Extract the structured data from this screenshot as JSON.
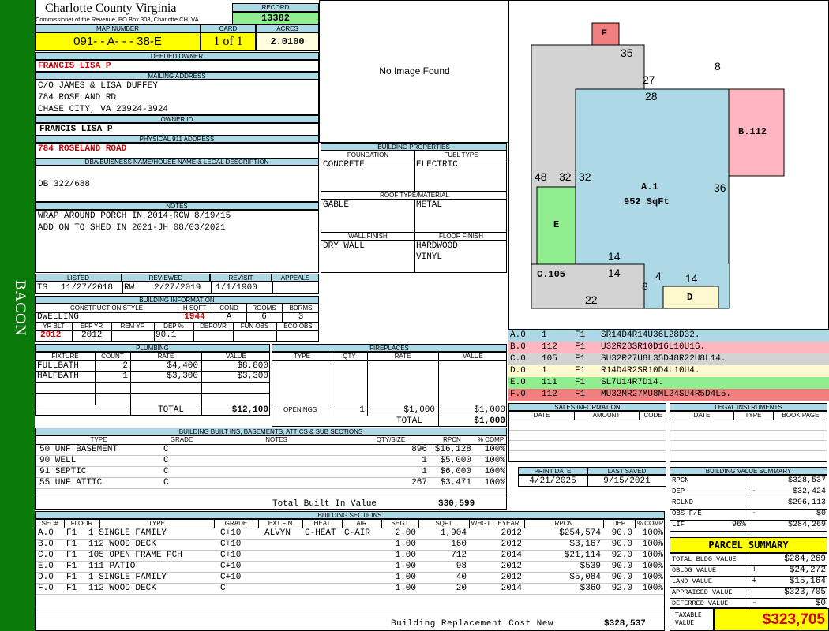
{
  "sidebar": {
    "label": "BACON",
    "color": "#087a08"
  },
  "header": {
    "county": "Charlotte County Virginia",
    "commissioner": "Commissioner of the Revenue, PO Box 308, Charlotte CH, VA",
    "record_label": "RECORD",
    "record": "13382",
    "map_number_label": "MAP NUMBER",
    "map_number": "091- - A- - - 38-E",
    "card_label": "CARD",
    "card": "1 of 1",
    "acres_label": "ACRES",
    "acres": "2.0100"
  },
  "owner": {
    "deeded_owner_label": "DEEDED OWNER",
    "deeded_owner": "FRANCIS LISA P",
    "mailing_label": "MAILING ADDRESS",
    "mailing": [
      "C/O JAMES & LISA DUFFEY",
      "784 ROSELAND RD",
      "CHASE CITY, VA 23924-3924"
    ],
    "owner_id_label": "OWNER ID",
    "owner_id": "FRANCIS LISA P",
    "physical_label": "PHYSICAL 911 ADDRESS",
    "physical": "784 ROSELAND ROAD",
    "dba_label": "DBA/BUISNESS NAME/HOUSE NAME & LEGAL DESCRIPTION",
    "dba": "DB 322/688",
    "notes_label": "NOTES",
    "notes": [
      "WRAP AROUND PORCH IN 2014-RCW 8/19/15",
      "ADD ON TO SHED IN 2021-JH 08/03/2021"
    ]
  },
  "image": {
    "text": "No Image Found"
  },
  "building_props": {
    "title": "BUILDING PROPERTIES",
    "foundation_label": "FOUNDATION",
    "foundation": "CONCRETE",
    "fuel_label": "FUEL TYPE",
    "fuel": "ELECTRIC",
    "roof_label": "ROOF TYPE/MATERIAL",
    "roof_type": "GABLE",
    "roof_material": "METAL",
    "wall_label": "WALL FINISH",
    "wall": "DRY WALL",
    "floor_label": "FLOOR FINISH",
    "floor": [
      "HARDWOOD",
      "VINYL"
    ]
  },
  "listing": {
    "listed_label": "LISTED",
    "listed_by": "TS",
    "listed_date": "11/27/2018",
    "reviewed_label": "REVIEWED",
    "reviewed_by": "RW",
    "reviewed_date": "2/27/2019",
    "revisit_label": "REVISIT",
    "revisit": "1/1/1900",
    "appeals_label": "APPEALS",
    "appeals": ""
  },
  "building_info": {
    "title": "BUILDING INFORMATION",
    "style_label": "CONSTRUCTION STYLE",
    "style": "DWELLING",
    "hsqft_label": "H SQFT",
    "hsqft": "1944",
    "cond_label": "COND",
    "cond": "A",
    "rooms_label": "ROOMS",
    "rooms": "6",
    "bdrms_label": "BDRMS",
    "bdrms": "3",
    "yrblt_label": "YR BLT",
    "yrblt": "2012",
    "effyr_label": "EFF YR",
    "effyr": "2012",
    "remyr_label": "REM YR",
    "remyr": "",
    "dep_label": "DEP %",
    "dep": "90.1",
    "depovr_label": "DEPOVR",
    "depovr": "",
    "funobs_label": "FUN OBS",
    "funobs": "",
    "ecoobs_label": "ECO OBS",
    "ecoobs": ""
  },
  "plumbing": {
    "title": "PLUMBING",
    "headers": [
      "FIXTURE",
      "COUNT",
      "RATE",
      "VALUE"
    ],
    "rows": [
      {
        "fixture": "FULLBATH",
        "count": "2",
        "rate": "$4,400",
        "value": "$8,800"
      },
      {
        "fixture": "HALFBATH",
        "count": "1",
        "rate": "$3,300",
        "value": "$3,300"
      }
    ],
    "total_label": "TOTAL",
    "total": "$12,100"
  },
  "fireplaces": {
    "title": "FIREPLACES",
    "headers": [
      "TYPE",
      "QTY",
      "RATE",
      "VALUE"
    ],
    "openings_label": "OPENINGS",
    "openings_qty": "1",
    "openings_rate": "$1,000",
    "openings_value": "$1,000",
    "total_label": "TOTAL",
    "total": "$1,000"
  },
  "built_ins": {
    "title": "BUILDING BUILT INS, BASEMENTS, ATTICS & SUB SECTIONS",
    "headers": [
      "TYPE",
      "GRADE",
      "NOTES",
      "QTY/SIZE",
      "RPCN",
      "% COMP"
    ],
    "rows": [
      {
        "type": "50 UNF BASEMENT",
        "grade": "C",
        "notes": "",
        "qty": "896",
        "rpcn": "$16,128",
        "comp": "100%"
      },
      {
        "type": "90 WELL",
        "grade": "C",
        "notes": "",
        "qty": "1",
        "rpcn": "$5,000",
        "comp": "100%"
      },
      {
        "type": "91 SEPTIC",
        "grade": "C",
        "notes": "",
        "qty": "1",
        "rpcn": "$6,000",
        "comp": "100%"
      },
      {
        "type": "55 UNF ATTIC",
        "grade": "C",
        "notes": "",
        "qty": "267",
        "rpcn": "$3,471",
        "comp": "100%"
      }
    ],
    "total_label": "Total Built In Value",
    "total": "$30,599"
  },
  "sketch": {
    "labels": {
      "F": "F",
      "B": "B.112",
      "A1": "A.1",
      "A2": "952 SqFt",
      "E": "E",
      "C": "C.105",
      "D": "D"
    },
    "dims": [
      "35",
      "8",
      "27",
      "28",
      "48",
      "32",
      "32",
      "36",
      "14",
      "14",
      "4",
      "14",
      "8",
      "22"
    ],
    "colors": {
      "A": "#add8e6",
      "B": "#ffb6c1",
      "C": "#d3d3d3",
      "D": "#fffacd",
      "E": "#90ee90",
      "F": "#f08080"
    }
  },
  "sketch_legend": [
    {
      "code": "A.0",
      "num": "1",
      "floor": "F1",
      "desc": "SR14D4R14U36L28D32.",
      "color": "#add8e6"
    },
    {
      "code": "B.0",
      "num": "112",
      "floor": "F1",
      "desc": "U32R28SR10D16L10U16.",
      "color": "#ffb6c1"
    },
    {
      "code": "C.0",
      "num": "105",
      "floor": "F1",
      "desc": "SU32R27U8L35D48R22U8L14.",
      "color": "#d3d3d3"
    },
    {
      "code": "D.0",
      "num": "1",
      "floor": "F1",
      "desc": "R14D4R2SR10D4L10U4.",
      "color": "#fffacd"
    },
    {
      "code": "E.0",
      "num": "111",
      "floor": "F1",
      "desc": "SL7U14R7D14.",
      "color": "#90ee90"
    },
    {
      "code": "F.0",
      "num": "112",
      "floor": "F1",
      "desc": "MU32MR27MU8ML24SU4R5D4L5.",
      "color": "#f08080"
    }
  ],
  "sales": {
    "title": "SALES INFORMATION",
    "headers": [
      "DATE",
      "AMOUNT",
      "CODE"
    ]
  },
  "legal": {
    "title": "LEGAL INSTRUMENTS",
    "headers": [
      "DATE",
      "TYPE",
      "BOOK PAGE"
    ]
  },
  "dates": {
    "print_label": "PRINT DATE",
    "print": "4/21/2025",
    "saved_label": "LAST SAVED",
    "saved": "9/15/2021"
  },
  "value_summary": {
    "title": "BUILDING VALUE SUMMARY",
    "rows": [
      {
        "label": "RPCN",
        "sign": "",
        "value": "$328,537"
      },
      {
        "label": "DEP",
        "sign": "-",
        "value": "$32,424"
      },
      {
        "label": "RCLND",
        "sign": "",
        "value": "$296,113"
      },
      {
        "label": "OBS F/E",
        "sign": "-",
        "value": "$0"
      },
      {
        "label": "LIF",
        "pct": "96%",
        "sign": "",
        "value": "$284,269"
      }
    ]
  },
  "parcel": {
    "title": "PARCEL SUMMARY",
    "rows": [
      {
        "label": "TOTAL BLDG VALUE",
        "sign": "",
        "value": "$284,269"
      },
      {
        "label": "OBLDG VALUE",
        "sign": "+",
        "value": "$24,272"
      },
      {
        "label": "LAND VALUE",
        "sign": "+",
        "value": "$15,164"
      },
      {
        "label": "APPRAISED VALUE",
        "sign": "",
        "value": "$323,705"
      },
      {
        "label": "DEFERRED VALUE",
        "sign": "-",
        "value": "$0"
      }
    ],
    "taxable_label": "TAXABLE VALUE",
    "taxable": "$323,705"
  },
  "sections": {
    "title": "BUILDING SECTIONS",
    "headers": [
      "SEC#",
      "FLOOR",
      "TYPE",
      "GRADE",
      "EXT FIN",
      "HEAT",
      "AIR",
      "SHGT",
      "SQFT",
      "WHGT",
      "EYEAR",
      "RPCN",
      "DEP",
      "% COMP"
    ],
    "rows": [
      {
        "sec": "A.0",
        "floor": "F1",
        "type": "1 SINGLE FAMILY",
        "grade": "C+10",
        "ext": "ALVYN",
        "heat": "C-HEAT",
        "air": "C-AIR",
        "shgt": "2.00",
        "sqft": "1,904",
        "whgt": "",
        "eyear": "2012",
        "rpcn": "$254,574",
        "dep": "90.0",
        "comp": "100%"
      },
      {
        "sec": "B.0",
        "floor": "F1",
        "type": "112 WOOD DECK",
        "grade": "C+10",
        "ext": "",
        "heat": "",
        "air": "",
        "shgt": "1.00",
        "sqft": "160",
        "whgt": "",
        "eyear": "2012",
        "rpcn": "$3,167",
        "dep": "90.0",
        "comp": "100%"
      },
      {
        "sec": "C.0",
        "floor": "F1",
        "type": "105 OPEN FRAME PCH",
        "grade": "C+10",
        "ext": "",
        "heat": "",
        "air": "",
        "shgt": "1.00",
        "sqft": "712",
        "whgt": "",
        "eyear": "2014",
        "rpcn": "$21,114",
        "dep": "92.0",
        "comp": "100%"
      },
      {
        "sec": "E.0",
        "floor": "F1",
        "type": "111 PATIO",
        "grade": "C+10",
        "ext": "",
        "heat": "",
        "air": "",
        "shgt": "1.00",
        "sqft": "98",
        "whgt": "",
        "eyear": "2012",
        "rpcn": "$539",
        "dep": "90.0",
        "comp": "100%"
      },
      {
        "sec": "D.0",
        "floor": "F1",
        "type": "1 SINGLE FAMILY",
        "grade": "C+10",
        "ext": "",
        "heat": "",
        "air": "",
        "shgt": "1.00",
        "sqft": "40",
        "whgt": "",
        "eyear": "2012",
        "rpcn": "$5,084",
        "dep": "90.0",
        "comp": "100%"
      },
      {
        "sec": "F.0",
        "floor": "F1",
        "type": "112 WOOD DECK",
        "grade": "C",
        "ext": "",
        "heat": "",
        "air": "",
        "shgt": "1.00",
        "sqft": "20",
        "whgt": "",
        "eyear": "2014",
        "rpcn": "$360",
        "dep": "92.0",
        "comp": "100%"
      }
    ],
    "total_label": "Building Replacement Cost New",
    "total": "$328,537"
  }
}
